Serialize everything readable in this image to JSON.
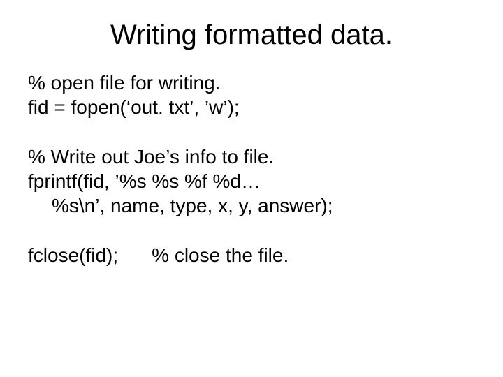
{
  "title": "Writing formatted data.",
  "block1": {
    "line1": "% open file for writing.",
    "line2": "fid = fopen(‘out. txt’, ’w’);"
  },
  "block2": {
    "line1": "% Write out Joe’s info to file.",
    "line2": "fprintf(fid, ’%s %s %f %d…",
    "line3": "%s\\n’, name, type, x, y, answer);"
  },
  "block3": {
    "left": "fclose(fid);",
    "right": "% close the file."
  }
}
